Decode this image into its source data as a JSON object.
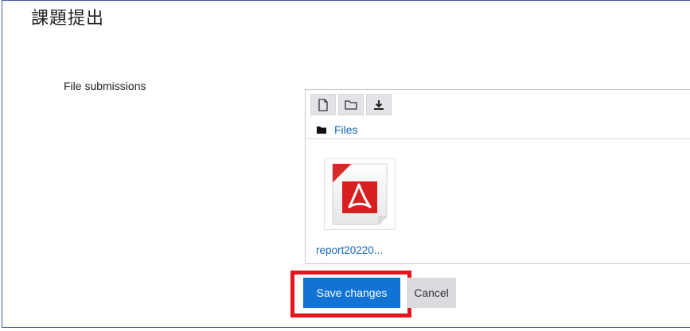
{
  "page": {
    "title": "課題提出"
  },
  "form": {
    "field_label": "File submissions",
    "file_manager": {
      "toolbar": [
        {
          "icon": "file-icon"
        },
        {
          "icon": "folder-icon"
        },
        {
          "icon": "download-icon"
        }
      ],
      "path_icon": "folder-filled-icon",
      "path_label": "Files",
      "files": [
        {
          "name": "report20220...",
          "icon": "pdf-icon"
        }
      ]
    },
    "buttons": {
      "save_label": "Save changes",
      "cancel_label": "Cancel"
    }
  },
  "colors": {
    "primary": "#1173d4",
    "link": "#1766b5",
    "highlight": "#e8131c",
    "frame": "#3c5aa6"
  }
}
